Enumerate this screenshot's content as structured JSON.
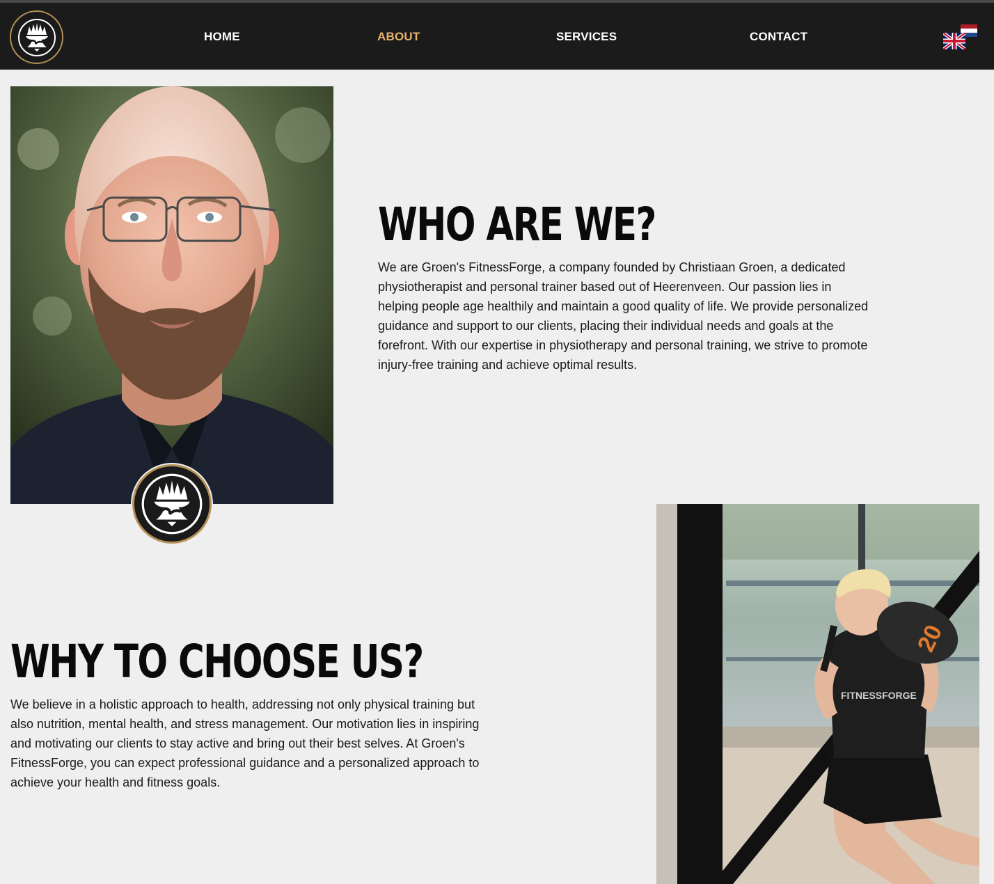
{
  "header": {
    "logo_icon": "anvil-flame-logo-icon",
    "nav": [
      {
        "label": "HOME",
        "active": false
      },
      {
        "label": "ABOUT",
        "active": true
      },
      {
        "label": "SERVICES",
        "active": false
      },
      {
        "label": "CONTACT",
        "active": false
      }
    ],
    "language_flags": [
      "uk-flag-icon",
      "nl-flag-icon"
    ],
    "colors": {
      "background": "#1b1b1b",
      "active_nav": "#e9b36b",
      "nav": "#ffffff",
      "logo_ring": "#b59157"
    }
  },
  "who": {
    "heading": "WHO ARE WE?",
    "text": "We are Groen's FitnessForge, a company founded by Christiaan Groen, a dedicated physiotherapist and personal trainer based out of Heerenveen. Our passion lies in helping people age healthily and maintain a good quality of life. We provide personalized guidance and support to our clients, placing their individual needs and goals at the forefront. With our expertise in physiotherapy and personal training, we strive to promote injury-free training and achieve optimal results."
  },
  "why": {
    "heading": "WHY TO CHOOSE US?",
    "text": "We believe in a holistic approach to health, addressing not only physical training but also nutrition, mental health, and stress management. Our motivation lies in inspiring and motivating our clients to stay active and bring out their best selves. At Groen's FitnessForge, you can expect professional guidance and a personalized approach to achieve your health and fitness goals."
  },
  "photos": {
    "founder_photo": "portrait-photo",
    "training_photo": "training-photo",
    "sandbag_label": "20"
  },
  "page": {
    "background": "#efefef"
  }
}
